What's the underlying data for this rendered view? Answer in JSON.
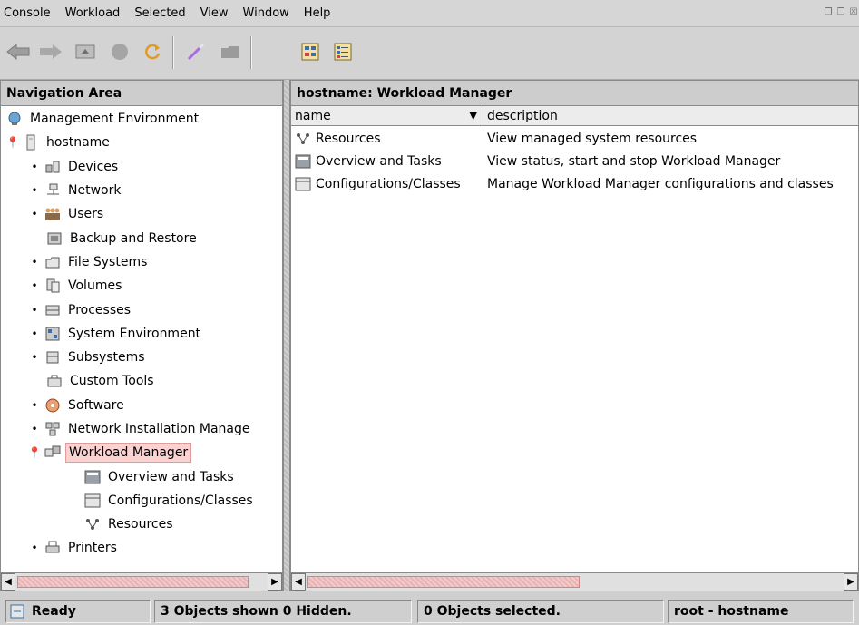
{
  "menubar": {
    "items": [
      {
        "label": "Console"
      },
      {
        "label": "Workload"
      },
      {
        "label": "Selected"
      },
      {
        "label": "View"
      },
      {
        "label": "Window"
      },
      {
        "label": "Help"
      }
    ]
  },
  "navigation": {
    "title": "Navigation Area",
    "items": [
      {
        "label": "Management Environment",
        "icon": "globe-icon"
      },
      {
        "label": "hostname",
        "icon": "server-icon"
      },
      {
        "label": "Devices",
        "icon": "devices-icon"
      },
      {
        "label": "Network",
        "icon": "network-icon"
      },
      {
        "label": "Users",
        "icon": "users-icon"
      },
      {
        "label": "Backup and Restore",
        "icon": "backup-icon"
      },
      {
        "label": "File Systems",
        "icon": "filesystems-icon"
      },
      {
        "label": "Volumes",
        "icon": "volumes-icon"
      },
      {
        "label": "Processes",
        "icon": "processes-icon"
      },
      {
        "label": "System Environment",
        "icon": "system-environment-icon"
      },
      {
        "label": "Subsystems",
        "icon": "subsystems-icon"
      },
      {
        "label": "Custom Tools",
        "icon": "custom-tools-icon"
      },
      {
        "label": "Software",
        "icon": "software-icon"
      },
      {
        "label": "Network Installation Manage",
        "icon": "network-installation-icon"
      },
      {
        "label": "Workload Manager",
        "icon": "workload-manager-icon"
      },
      {
        "label": "Overview and Tasks",
        "icon": "overview-icon"
      },
      {
        "label": "Configurations/Classes",
        "icon": "configurations-icon"
      },
      {
        "label": "Resources",
        "icon": "resources-icon"
      },
      {
        "label": "Printers",
        "icon": "printers-icon"
      }
    ]
  },
  "main": {
    "title": "hostname: Workload Manager",
    "columns": {
      "name": "name",
      "description": "description"
    },
    "rows": [
      {
        "name": "Resources",
        "description": "View managed system resources",
        "icon": "resources-icon"
      },
      {
        "name": "Overview and Tasks",
        "description": "View status, start and stop Workload Manager",
        "icon": "overview-icon"
      },
      {
        "name": "Configurations/Classes",
        "description": "Manage Workload Manager configurations and classes",
        "icon": "configurations-icon"
      }
    ]
  },
  "status": {
    "ready": "Ready",
    "shown": "3 Objects shown 0 Hidden.",
    "selected": "0 Objects selected.",
    "user": "root - hostname"
  },
  "colors": {
    "selected_bg": "#fbd2d2",
    "panel_header": "#cdcdcd",
    "background": "#cfcfcf"
  }
}
